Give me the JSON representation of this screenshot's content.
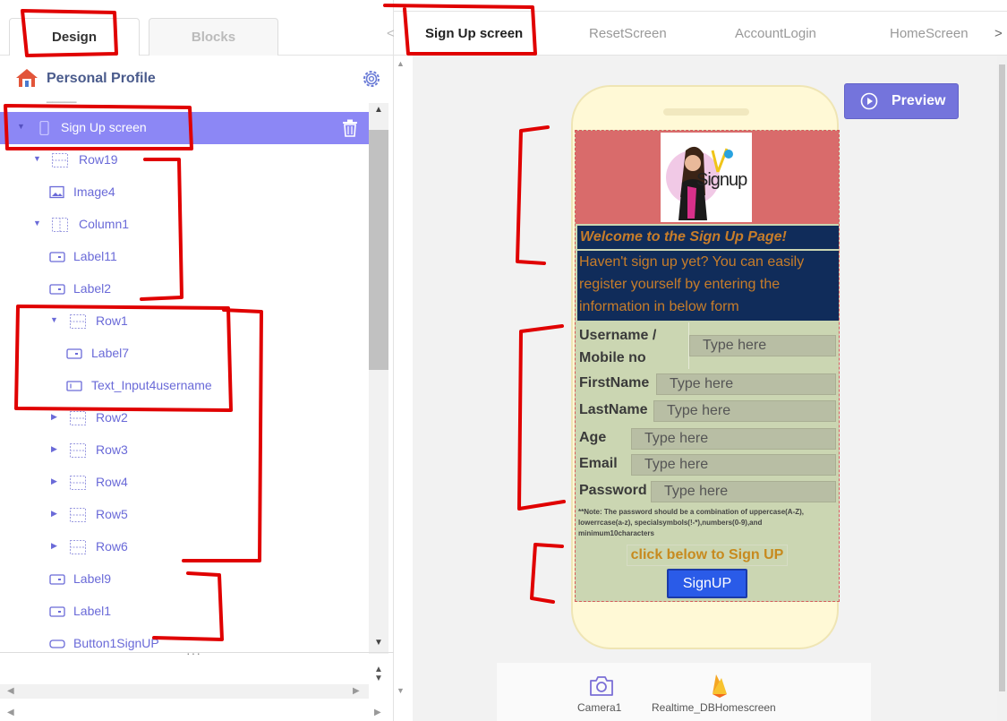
{
  "left_tabs": {
    "design": "Design",
    "blocks": "Blocks",
    "collapse_arrow": "<"
  },
  "project": {
    "title": "Personal Profile"
  },
  "tree": {
    "cut_text": "_____",
    "items": [
      {
        "label": "Sign Up screen",
        "type": "screen",
        "expanded": true,
        "selected": true
      },
      {
        "label": "Row19",
        "type": "row",
        "expanded": true
      },
      {
        "label": "Image4",
        "type": "image"
      },
      {
        "label": "Column1",
        "type": "column",
        "expanded": true
      },
      {
        "label": "Label11",
        "type": "label"
      },
      {
        "label": "Label2",
        "type": "label"
      },
      {
        "label": "Row1",
        "type": "row",
        "expanded": true
      },
      {
        "label": "Label7",
        "type": "label"
      },
      {
        "label": "Text_Input4username",
        "type": "textinput"
      },
      {
        "label": "Row2",
        "type": "row",
        "expanded": false
      },
      {
        "label": "Row3",
        "type": "row",
        "expanded": false
      },
      {
        "label": "Row4",
        "type": "row",
        "expanded": false
      },
      {
        "label": "Row5",
        "type": "row",
        "expanded": false
      },
      {
        "label": "Row6",
        "type": "row",
        "expanded": false
      },
      {
        "label": "Label9",
        "type": "label"
      },
      {
        "label": "Label1",
        "type": "label"
      },
      {
        "label": "Button1SignUP",
        "type": "button"
      }
    ]
  },
  "splitter": {
    "dots": "···"
  },
  "screen_tabs": {
    "prev": "<",
    "next": ">",
    "items": [
      "Sign Up screen",
      "ResetScreen",
      "AccountLogin",
      "HomeScreen"
    ]
  },
  "preview": {
    "label": "Preview"
  },
  "app": {
    "image_text": "Signup",
    "welcome": "Welcome to the Sign Up Page!",
    "intro": "Haven't sign up yet? You can easily register yourself by entering the information in below form",
    "fields": [
      {
        "label": "Username / Mobile no",
        "placeholder": "Type here"
      },
      {
        "label": "FirstName",
        "placeholder": "Type here"
      },
      {
        "label": "LastName",
        "placeholder": "Type here"
      },
      {
        "label": "Age",
        "placeholder": "Type here"
      },
      {
        "label": "Email",
        "placeholder": "Type here"
      },
      {
        "label": "Password",
        "placeholder": "Type here"
      }
    ],
    "note": "**Note: The password should be a combination of uppercase(A-Z), lowerrcase(a-z), specialsymbols(!-*),numbers(0-9),and minimum10characters",
    "cta": "click below to Sign UP",
    "signup_button": "SignUP"
  },
  "nonvisible": {
    "items": [
      {
        "label": "Camera1",
        "icon": "camera-icon"
      },
      {
        "label": "Realtime_DBHomescreen",
        "icon": "firebase-icon"
      }
    ]
  },
  "colors": {
    "accent": "#7474dc",
    "selected_row": "#8c87f5",
    "tree_text": "#6a6ad8",
    "header_red": "#d96b6b",
    "dark_blue": "#102c5a",
    "orange_text": "#c77d2a",
    "form_bg": "#cbd6b2",
    "signup_blue": "#2a5be8",
    "annotation_red": "#e00000"
  }
}
